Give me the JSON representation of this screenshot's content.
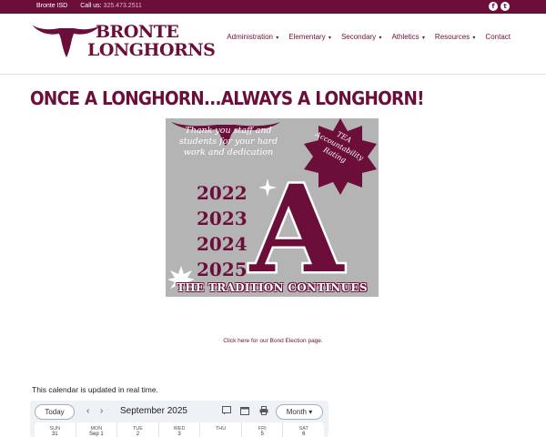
{
  "topbar": {
    "district": "Bronte ISD",
    "call_label": "Call us:",
    "phone": "325.473.2511",
    "social": [
      {
        "icon": "facebook-icon",
        "glyph": "f"
      },
      {
        "icon": "twitter-icon",
        "glyph": "t"
      }
    ]
  },
  "header": {
    "logo_line1": "BRONTE",
    "logo_line2": "LONGHORNS",
    "nav": [
      {
        "label": "Administration",
        "caret": "▾"
      },
      {
        "label": "Elementary",
        "caret": "▾"
      },
      {
        "label": "Secondary",
        "caret": "▾"
      },
      {
        "label": "Athletics",
        "caret": "▾"
      },
      {
        "label": "Resources",
        "caret": "▾"
      },
      {
        "label": "Contact",
        "caret": ""
      }
    ]
  },
  "main": {
    "headline": "ONCE A LONGHORN...ALWAYS A LONGHORN!",
    "poster": {
      "thanks": "Thank you staff and students for your hard work and dedication",
      "years": [
        "2022",
        "2023",
        "2024",
        "2025"
      ],
      "grade": "A",
      "tea_badge": "TEA Accountability Rating",
      "tradition": "THE TRADITION CONTINUES"
    },
    "bond_link": "Click here for our Bond Election page.",
    "calendar_note": "This calendar is updated in real time."
  },
  "calendar": {
    "today_label": "Today",
    "prev": "‹",
    "next": "›",
    "month_label": "September 2025",
    "view_label": "Month",
    "view_caret": "▾",
    "days": [
      {
        "dow": "SUN",
        "num": "31",
        "today": false
      },
      {
        "dow": "MON",
        "num": "Sep 1",
        "today": false
      },
      {
        "dow": "TUE",
        "num": "2",
        "today": false
      },
      {
        "dow": "WED",
        "num": "3",
        "today": false
      },
      {
        "dow": "THU",
        "num": "4",
        "today": true
      },
      {
        "dow": "FRI",
        "num": "5",
        "today": false
      },
      {
        "dow": "SAT",
        "num": "6",
        "today": false
      }
    ]
  },
  "colors": {
    "brand_maroon": "#6b0f3a",
    "poster_gray": "#b4b4b4",
    "today_blue": "#1a73e8"
  }
}
